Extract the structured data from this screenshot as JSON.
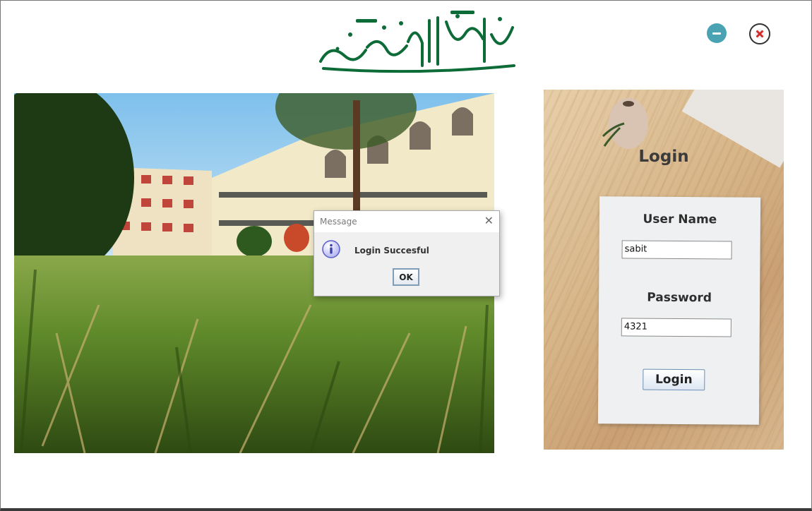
{
  "header": {
    "logo_icon": "bismillah-calligraphy",
    "logo_text": "بسم الله الرحمن الرحيم",
    "minimize_icon": "minimize-icon",
    "close_icon": "close-icon"
  },
  "photo": {
    "icon": "campus-photo"
  },
  "login": {
    "title": "Login",
    "username_label": "User Name",
    "username_value": "sabit",
    "password_label": "Password",
    "password_value": "4321",
    "button_label": "Login"
  },
  "dialog": {
    "title": "Message",
    "message": "Login Succesful",
    "ok_label": "OK",
    "close_glyph": "✕",
    "icon": "info-icon"
  },
  "colors": {
    "logo_green": "#0d6b38",
    "minimize": "#4aa3b3",
    "close_x": "#d42a2a",
    "info_blue": "#5b5fc7"
  }
}
